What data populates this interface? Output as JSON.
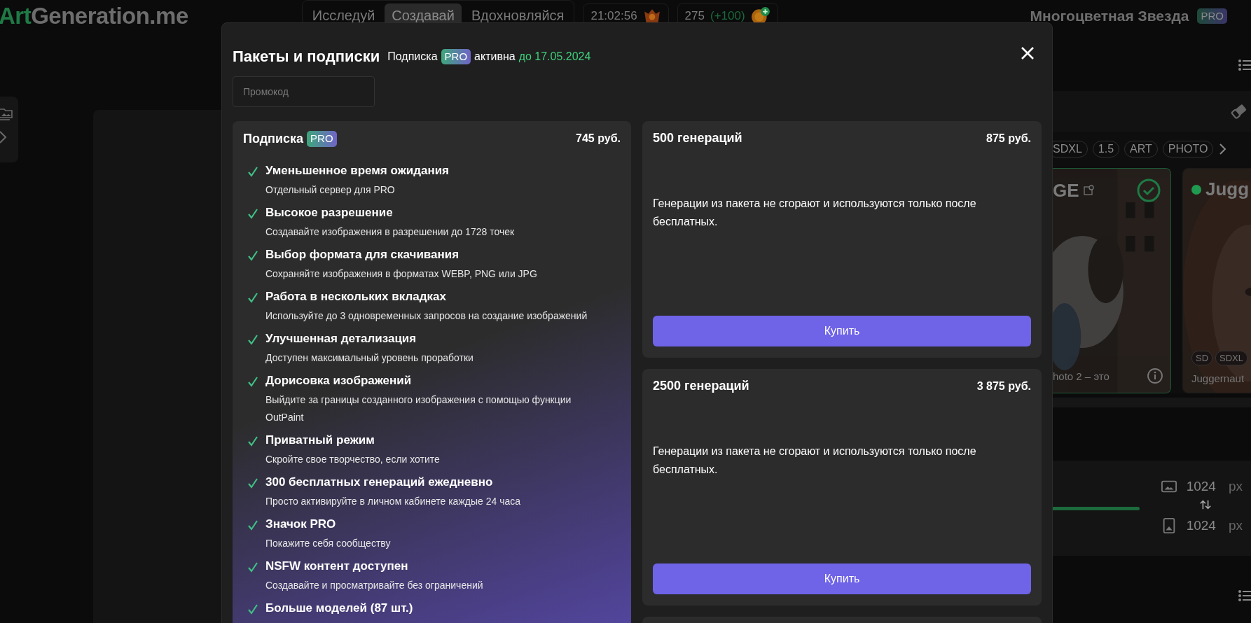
{
  "header": {
    "logo": {
      "accent": "Art",
      "rest": "Generation.me"
    },
    "tabs": [
      {
        "label": "Исследуй",
        "selected": false
      },
      {
        "label": "Создавай",
        "selected": true
      },
      {
        "label": "Вдохновляйся",
        "selected": false
      }
    ],
    "clock": "21:02:56",
    "credits": "275",
    "bonus": "(+100)",
    "username": "Многоцветная Звезда",
    "badge": "PRO"
  },
  "background": {
    "chips": [
      "SDXL",
      "1.5",
      "ART",
      "PHOTO"
    ],
    "models": [
      {
        "title": "GE",
        "caption": "hoto 2 – это",
        "selected": true
      },
      {
        "title": "Jugg",
        "caption": "Juggernaut",
        "selected": false,
        "tags": [
          "SD",
          "SDXL"
        ]
      }
    ],
    "sizes": [
      {
        "value": "1024",
        "unit": "px",
        "kind": "landscape"
      },
      {
        "value": "1024",
        "unit": "px",
        "kind": "portrait"
      }
    ]
  },
  "modal": {
    "title": "Пакеты и подписки",
    "status": {
      "prefix": "Подписка",
      "badge": "PRO",
      "state": "активна",
      "until": "до 17.05.2024"
    },
    "promo": {
      "placeholder": "Промокод"
    },
    "subscription": {
      "title": "Подписка",
      "badge": "PRO",
      "price": "745 руб.",
      "features": [
        {
          "title": "Уменьшенное время ожидания",
          "desc": "Отдельный сервер для PRO"
        },
        {
          "title": "Высокое разрешение",
          "desc": "Создавайте изображения в разрешении до 1728 точек"
        },
        {
          "title": "Выбор формата для скачивания",
          "desc": "Сохраняйте изображения в форматах WEBP, PNG или JPG"
        },
        {
          "title": "Работа в нескольких вкладках",
          "desc": "Используйте до 3 одновременных запросов на создание изображений"
        },
        {
          "title": "Улучшенная детализация",
          "desc": "Доступен максимальный уровень проработки"
        },
        {
          "title": "Дорисовка изображений",
          "desc": "Выйдите за границы созданного изображения с помощью функции OutPaint"
        },
        {
          "title": "Приватный режим",
          "desc": "Скройте свое творчество, если хотите"
        },
        {
          "title": "300 бесплатных генераций ежедневно",
          "desc": "Просто активируйте в личном кабинете каждые 24 часа"
        },
        {
          "title": "Значок PRO",
          "desc": "Покажите себя сообществу"
        },
        {
          "title": "NSFW контент доступен",
          "desc": "Создавайте и просматривайте без ограничений"
        },
        {
          "title": "Больше моделей (87 шт.)"
        }
      ]
    },
    "packages": [
      {
        "title": "500 генераций",
        "price": "875 руб.",
        "desc": "Генерации из пакета не сгорают и используются только после бесплатных.",
        "button": "Купить"
      },
      {
        "title": "2500 генераций",
        "price": "3 875 руб.",
        "desc": "Генерации из пакета не сгорают и используются только после бесплатных.",
        "button": "Купить"
      }
    ]
  }
}
